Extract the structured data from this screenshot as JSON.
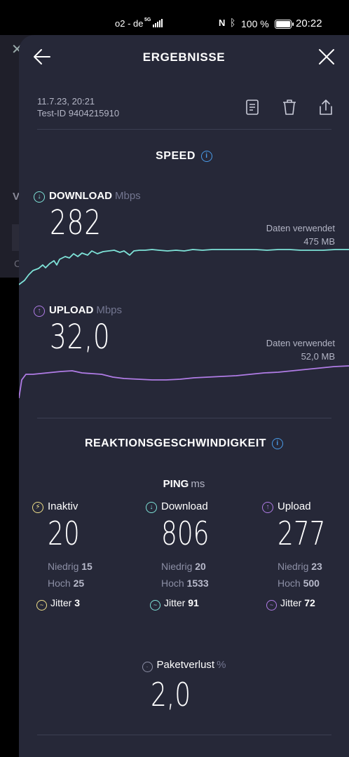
{
  "status_bar": {
    "carrier": "o2 - de",
    "network": "5G",
    "battery": "100 %",
    "time": "20:22"
  },
  "header": {
    "title": "ERGEBNISSE"
  },
  "meta": {
    "date": "11.7.23, 20:21",
    "test_id": "Test-ID 9404215910"
  },
  "speed": {
    "title": "SPEED",
    "download": {
      "label": "DOWNLOAD",
      "unit": "Mbps",
      "value": "282",
      "data_used_label": "Daten verwendet",
      "data_used": "475 MB",
      "color": "#7ee3d8"
    },
    "upload": {
      "label": "UPLOAD",
      "unit": "Mbps",
      "value": "32,0",
      "data_used_label": "Daten verwendet",
      "data_used": "52,0 MB",
      "color": "#b07ce6"
    }
  },
  "responsiveness": {
    "title": "REAKTIONSGESCHWINDIGKEIT",
    "ping_label": "PING",
    "ping_unit": "ms",
    "columns": [
      {
        "label": "Inaktiv",
        "value": "20",
        "low_label": "Niedrig",
        "low": "15",
        "high_label": "Hoch",
        "high": "25",
        "jitter_label": "Jitter",
        "jitter": "3",
        "color": "#f1e08a"
      },
      {
        "label": "Download",
        "value": "806",
        "low_label": "Niedrig",
        "low": "20",
        "high_label": "Hoch",
        "high": "1533",
        "jitter_label": "Jitter",
        "jitter": "91",
        "color": "#7ee3d8"
      },
      {
        "label": "Upload",
        "value": "277",
        "low_label": "Niedrig",
        "low": "23",
        "high_label": "Hoch",
        "high": "500",
        "jitter_label": "Jitter",
        "jitter": "72",
        "color": "#b07ce6"
      }
    ],
    "packet_loss_label": "Paketverlust",
    "packet_loss_unit": "%",
    "packet_loss": "2,0"
  }
}
